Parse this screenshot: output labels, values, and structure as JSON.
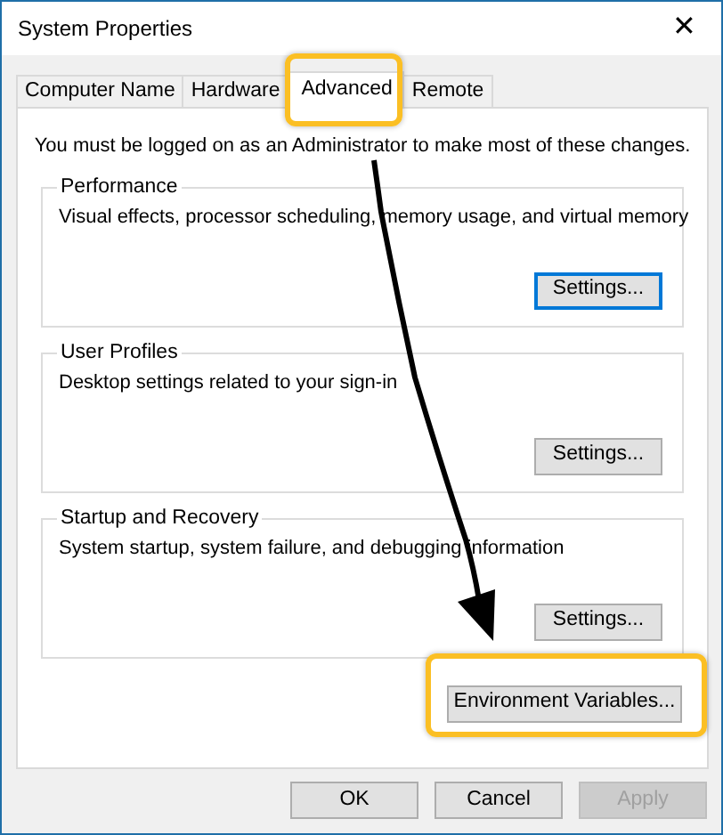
{
  "window": {
    "title": "System Properties",
    "close": "✕"
  },
  "tabs": [
    {
      "label": "Computer Name",
      "selected": false
    },
    {
      "label": "Hardware",
      "selected": false
    },
    {
      "label": "Advanced",
      "selected": true
    },
    {
      "label": "Remote",
      "selected": false
    }
  ],
  "note": "You must be logged on as an Administrator to make most of these changes.",
  "groups": [
    {
      "title": "Performance",
      "description": "Visual effects, processor scheduling, memory usage, and virtual memory",
      "button": {
        "label": "Settings...",
        "focused": true
      }
    },
    {
      "title": "User Profiles",
      "description": "Desktop settings related to your sign-in",
      "button": {
        "label": "Settings...",
        "focused": false
      }
    },
    {
      "title": "Startup and Recovery",
      "description": "System startup, system failure, and debugging information",
      "button": {
        "label": "Settings...",
        "focused": false
      }
    }
  ],
  "environment_button": {
    "label": "Environment Variables..."
  },
  "footer_buttons": [
    {
      "label": "OK",
      "disabled": false
    },
    {
      "label": "Cancel",
      "disabled": false
    },
    {
      "label": "Apply",
      "disabled": true
    }
  ]
}
